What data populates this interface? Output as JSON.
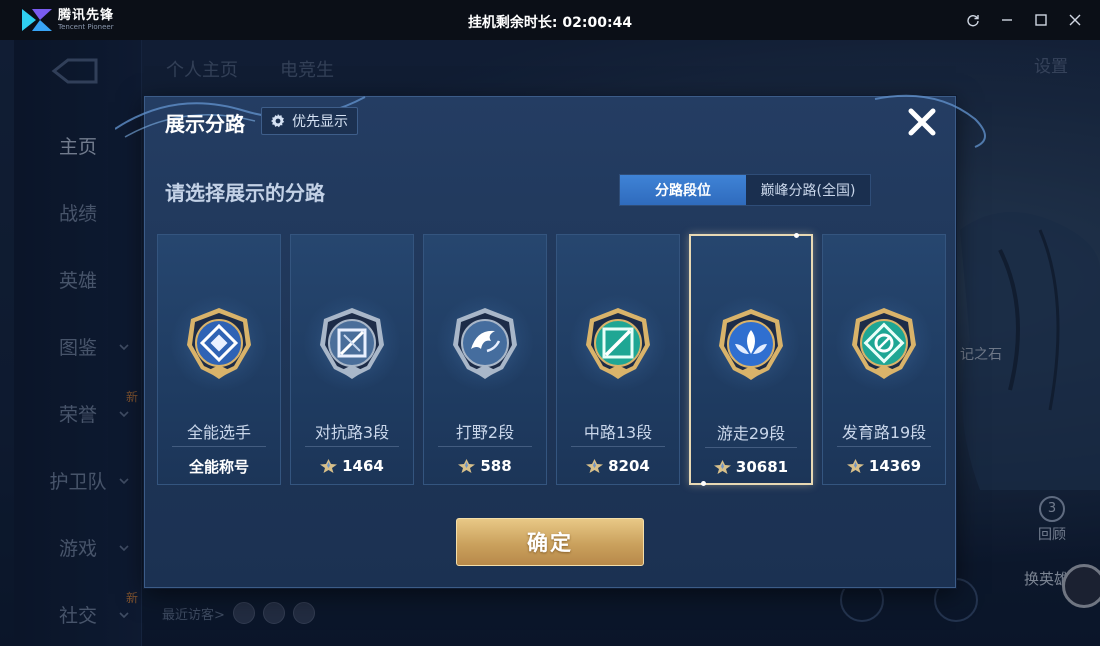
{
  "emulator": {
    "brand_name": "腾讯先锋",
    "brand_sub": "Tencent Pioneer",
    "controls": [
      "refresh-icon",
      "minimize-icon",
      "maximize-icon",
      "close-icon"
    ]
  },
  "timer": "挂机剩余时长: 02:00:44",
  "background": {
    "sidebar": [
      {
        "label": "主页",
        "chevron": false,
        "badge": ""
      },
      {
        "label": "战绩",
        "chevron": false,
        "badge": ""
      },
      {
        "label": "英雄",
        "chevron": false,
        "badge": ""
      },
      {
        "label": "图鉴",
        "chevron": true,
        "badge": ""
      },
      {
        "label": "荣誉",
        "chevron": true,
        "badge": "新"
      },
      {
        "label": "护卫队",
        "chevron": true,
        "badge": ""
      },
      {
        "label": "游戏",
        "chevron": true,
        "badge": ""
      },
      {
        "label": "社交",
        "chevron": true,
        "badge": "新"
      }
    ],
    "top_tabs": [
      "个人主页",
      "电竞生"
    ],
    "settings_label": "设置",
    "side_text": "记之石",
    "huiwu_label": "回顾",
    "switch_label": "换英雄",
    "recent_visitors_label": "最近访客>"
  },
  "modal": {
    "title": "展示分路",
    "priority_label": "优先显示",
    "prompt": "请选择展示的分路",
    "segments": [
      {
        "label": "分路段位",
        "active": true
      },
      {
        "label": "巅峰分路(全国)",
        "active": false
      }
    ],
    "cards": [
      {
        "rank": "全能选手",
        "footer": "全能称号",
        "show_icon": false,
        "badge": "allround",
        "selected": false
      },
      {
        "rank": "对抗路3段",
        "footer": "1464",
        "show_icon": true,
        "badge": "clash",
        "selected": false
      },
      {
        "rank": "打野2段",
        "footer": "588",
        "show_icon": true,
        "badge": "jungle",
        "selected": false
      },
      {
        "rank": "中路13段",
        "footer": "8204",
        "show_icon": true,
        "badge": "mid",
        "selected": false
      },
      {
        "rank": "游走29段",
        "footer": "30681",
        "show_icon": true,
        "badge": "roam",
        "selected": true
      },
      {
        "rank": "发育路19段",
        "footer": "14369",
        "show_icon": true,
        "badge": "farm",
        "selected": false
      }
    ],
    "confirm_label": "确定"
  },
  "colors": {
    "modal_bg": "#213a5e",
    "segment_active": "#3a7bd0",
    "confirm_gold": "#d4ad66",
    "selected_border": "#e8d9b4"
  }
}
